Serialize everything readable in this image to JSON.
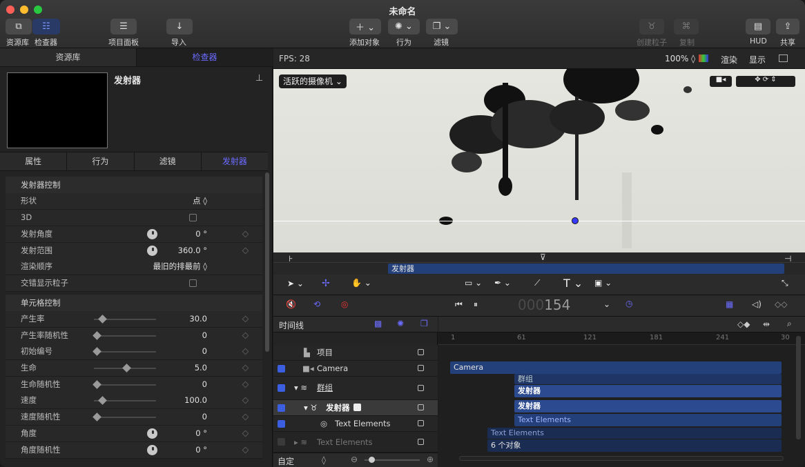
{
  "window": {
    "title": "未命名"
  },
  "toolbar": {
    "library_label": "资源库",
    "inspector_label": "检查器",
    "project_panel_label": "项目面板",
    "import_label": "导入",
    "add_object_label": "添加对象",
    "behaviors_label": "行为",
    "filters_label": "滤镜",
    "create_particles_label": "创建粒子",
    "replicate_label": "复制",
    "hud_label": "HUD",
    "share_label": "共享"
  },
  "left_panel": {
    "tabs": [
      "资源库",
      "检查器"
    ],
    "preview_title": "发射器",
    "sub_tabs": [
      "属性",
      "行为",
      "滤镜",
      "发射器"
    ],
    "section1": "发射器控制",
    "section2": "单元格控制",
    "rows1": [
      {
        "label": "形状",
        "value": "点 ◊"
      },
      {
        "label": "3D",
        "value": ""
      },
      {
        "label": "发射角度",
        "value": "0 °"
      },
      {
        "label": "发射范围",
        "value": "360.0 °"
      },
      {
        "label": "渲染顺序",
        "value": "最旧的排最前 ◊"
      },
      {
        "label": "交错显示粒子",
        "value": ""
      }
    ],
    "rows2": [
      {
        "label": "产生率",
        "value": "30.0"
      },
      {
        "label": "产生率随机性",
        "value": "0"
      },
      {
        "label": "初始编号",
        "value": "0"
      },
      {
        "label": "生命",
        "value": "5.0"
      },
      {
        "label": "生命随机性",
        "value": "0"
      },
      {
        "label": "速度",
        "value": "100.0"
      },
      {
        "label": "速度随机性",
        "value": "0"
      },
      {
        "label": "角度",
        "value": "0 °"
      },
      {
        "label": "角度随机性",
        "value": "0 °"
      }
    ]
  },
  "canvas": {
    "fps": "FPS: 28",
    "zoom": "100% ◊",
    "render": "渲染",
    "view": "显示",
    "camera_menu": "活跃的摄像机"
  },
  "mini_timeline": {
    "bar_label": "发射器"
  },
  "transport": {
    "timecode_dim": "000",
    "timecode": "154"
  },
  "layers_panel": {
    "title": "时间线",
    "rows": [
      {
        "name": "项目"
      },
      {
        "name": "Camera"
      },
      {
        "name": "群组"
      },
      {
        "name": "发射器"
      },
      {
        "name": "Text Elements"
      },
      {
        "name": "Text Elements"
      }
    ],
    "footer": "自定"
  },
  "timeline": {
    "ruler": [
      "1",
      "61",
      "121",
      "181",
      "241",
      "30"
    ],
    "bars": [
      "Camera",
      "群组",
      "发射器",
      "发射器",
      "Text Elements",
      "Text Elements",
      "6 个对象"
    ]
  },
  "colors": {
    "accent": "#6b6bff",
    "bar": "#24407a",
    "check": "#3b5fe0"
  }
}
